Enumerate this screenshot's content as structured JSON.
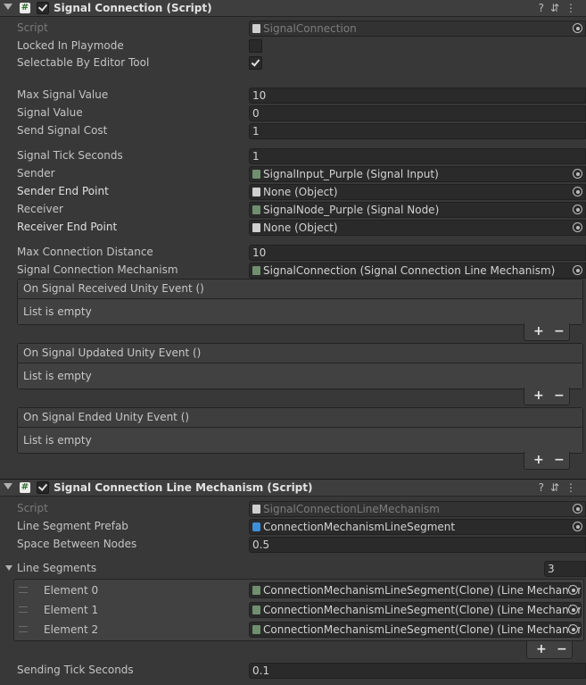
{
  "signal_connection": {
    "title": "Signal Connection (Script)",
    "script": {
      "label": "Script",
      "value": "SignalConnection"
    },
    "locked_in_playmode": {
      "label": "Locked In Playmode",
      "checked": false
    },
    "selectable_by_editor_tool": {
      "label": "Selectable By Editor Tool",
      "checked": true
    },
    "max_signal_value": {
      "label": "Max Signal Value",
      "value": "10"
    },
    "signal_value": {
      "label": "Signal Value",
      "value": "0"
    },
    "send_signal_cost": {
      "label": "Send Signal Cost",
      "value": "1"
    },
    "signal_tick_seconds": {
      "label": "Signal Tick Seconds",
      "value": "1"
    },
    "sender": {
      "label": "Sender",
      "value": "SignalInput_Purple (Signal Input)"
    },
    "sender_end_point": {
      "label": "Sender End Point",
      "value": "None (Object)"
    },
    "receiver": {
      "label": "Receiver",
      "value": "SignalNode_Purple (Signal Node)"
    },
    "receiver_end_point": {
      "label": "Receiver End Point",
      "value": "None (Object)"
    },
    "max_connection_distance": {
      "label": "Max Connection Distance",
      "value": "10"
    },
    "signal_connection_mechanism": {
      "label": "Signal Connection Mechanism",
      "value": "SignalConnection (Signal Connection Line Mechanism)"
    },
    "events": [
      {
        "title": "On Signal Received Unity Event ()",
        "body": "List is empty"
      },
      {
        "title": "On Signal Updated Unity Event ()",
        "body": "List is empty"
      },
      {
        "title": "On Signal Ended Unity Event ()",
        "body": "List is empty"
      }
    ]
  },
  "line_mechanism": {
    "title": "Signal Connection Line Mechanism (Script)",
    "script": {
      "label": "Script",
      "value": "SignalConnectionLineMechanism"
    },
    "line_segment_prefab": {
      "label": "Line Segment Prefab",
      "value": "ConnectionMechanismLineSegment"
    },
    "space_between_nodes": {
      "label": "Space Between Nodes",
      "value": "0.5"
    },
    "line_segments": {
      "label": "Line Segments",
      "count": "3",
      "elements": [
        {
          "label": "Element 0",
          "value": "ConnectionMechanismLineSegment(Clone) (Line Mechanism"
        },
        {
          "label": "Element 1",
          "value": "ConnectionMechanismLineSegment(Clone) (Line Mechanism"
        },
        {
          "label": "Element 2",
          "value": "ConnectionMechanismLineSegment(Clone) (Line Mechanism"
        }
      ]
    },
    "sending_tick_seconds": {
      "label": "Sending Tick Seconds",
      "value": "0.1"
    }
  },
  "header_icons": [
    "help-icon",
    "presets-icon",
    "more-menu-icon"
  ],
  "buttons": {
    "add": "+",
    "remove": "−"
  },
  "icon_glyphs": {
    "script": "#",
    "help": "?",
    "presets": "⇵",
    "more": "⋮"
  }
}
